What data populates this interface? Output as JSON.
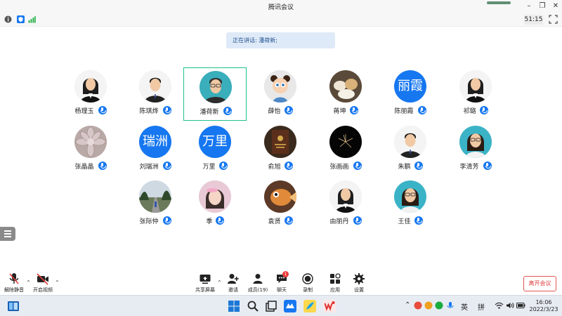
{
  "window": {
    "title": "腾讯会议"
  },
  "status": {
    "timer": "51:15"
  },
  "speaking": {
    "label": "正在讲话: 潘荷新;"
  },
  "participants": [
    {
      "name": "杨理玉",
      "avatar": "photo-portrait-woman"
    },
    {
      "name": "陈琪烨",
      "avatar": "photo-portrait-man"
    },
    {
      "name": "潘荷新",
      "avatar": "photo-portrait-man-glasses",
      "active": true
    },
    {
      "name": "薛怡",
      "avatar": "cartoon-girl"
    },
    {
      "name": "蒋坤",
      "avatar": "photo-food"
    },
    {
      "name": "陈丽霞",
      "avatar_text": "丽霞"
    },
    {
      "name": "祁璐",
      "avatar": "photo-portrait-woman"
    },
    {
      "name": "张晶晶",
      "avatar": "photo-succulent"
    },
    {
      "name": "刘瑞洲",
      "avatar_text": "瑞洲"
    },
    {
      "name": "万里",
      "avatar_text": "万里"
    },
    {
      "name": "俞旭",
      "avatar": "photo-certificate-book"
    },
    {
      "name": "张画画",
      "avatar": "photo-fireworks"
    },
    {
      "name": "朱鹏",
      "avatar": "photo-portrait-man"
    },
    {
      "name": "李清芳",
      "avatar": "photo-portrait-woman-glasses"
    },
    {
      "name": "张际仲",
      "avatar": "photo-outdoor-road"
    },
    {
      "name": "季",
      "avatar": "photo-selfie-pink"
    },
    {
      "name": "袁贤",
      "avatar": "photo-goldfish"
    },
    {
      "name": "由丽丹",
      "avatar": "photo-portrait-woman"
    },
    {
      "name": "王佳",
      "avatar": "photo-portrait-woman-glasses"
    }
  ],
  "toolbar": {
    "unmute": "解除静音",
    "start_video": "开启视频",
    "share_screen": "共享屏幕",
    "invite": "邀请",
    "members": "成员(19)",
    "chat": "聊天",
    "chat_badge": "1",
    "record": "录制",
    "apps": "应用",
    "settings": "设置",
    "leave": "离开会议"
  },
  "taskbar": {
    "ime_lang": "英",
    "ime_mode": "拼",
    "time": "16:06",
    "date": "2022/3/23"
  },
  "colors": {
    "accent": "#1677f0",
    "active_border": "#1fc28a",
    "leave": "#e03c3c"
  }
}
